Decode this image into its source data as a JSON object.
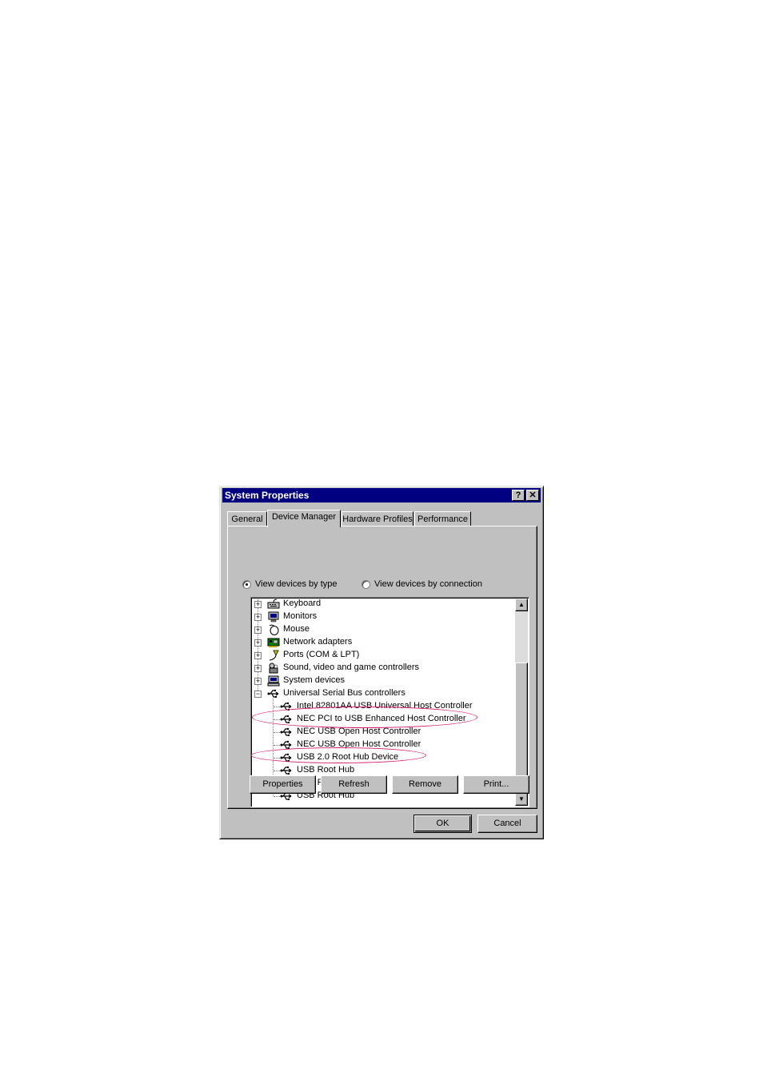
{
  "window": {
    "title": "System Properties",
    "help_button": "?",
    "close_button": "✕"
  },
  "tabs": [
    {
      "label": "General"
    },
    {
      "label": "Device Manager"
    },
    {
      "label": "Hardware Profiles"
    },
    {
      "label": "Performance"
    }
  ],
  "view_options": {
    "by_type": "View devices by type",
    "by_connection": "View devices by connection",
    "selected": "by_type"
  },
  "tree": {
    "categories": [
      {
        "label": "Keyboard",
        "icon": "keyboard-icon",
        "expander": "+"
      },
      {
        "label": "Monitors",
        "icon": "monitor-icon",
        "expander": "+"
      },
      {
        "label": "Mouse",
        "icon": "mouse-icon",
        "expander": "+"
      },
      {
        "label": "Network adapters",
        "icon": "network-card-icon",
        "expander": "+"
      },
      {
        "label": "Ports (COM & LPT)",
        "icon": "port-icon",
        "expander": "+"
      },
      {
        "label": "Sound, video and game controllers",
        "icon": "sound-icon",
        "expander": "+"
      },
      {
        "label": "System devices",
        "icon": "system-icon",
        "expander": "+"
      },
      {
        "label": "Universal Serial Bus controllers",
        "icon": "usb-icon",
        "expander": "−"
      }
    ],
    "usb_children": [
      {
        "label": "Intel 82801AA USB Universal Host Controller"
      },
      {
        "label": "NEC PCI to USB Enhanced Host Controller"
      },
      {
        "label": "NEC USB Open Host Controller"
      },
      {
        "label": "NEC USB Open Host Controller"
      },
      {
        "label": "USB 2.0 Root Hub Device"
      },
      {
        "label": "USB Root Hub"
      },
      {
        "label": "USB Root Hub"
      },
      {
        "label": "USB Root Hub"
      }
    ]
  },
  "buttons": {
    "properties": "Properties",
    "refresh": "Refresh",
    "remove": "Remove",
    "print": "Print...",
    "ok": "OK",
    "cancel": "Cancel"
  },
  "annotation_color": "#d6206e"
}
